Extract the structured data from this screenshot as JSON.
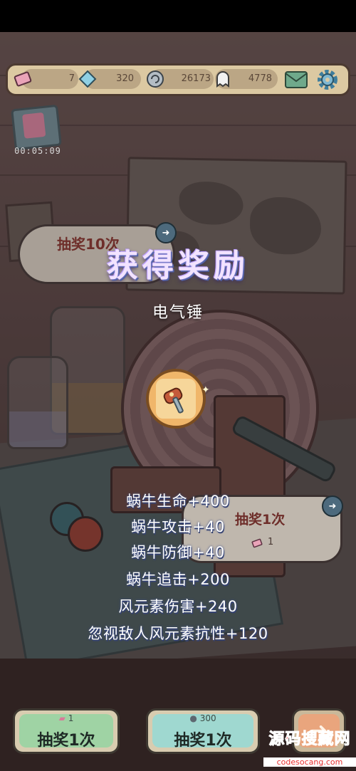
{
  "hud": {
    "tickets": "7",
    "gems": "320",
    "snail_coins": "26173",
    "ghost_coins": "4778",
    "icons": [
      "ticket-icon",
      "gem-icon",
      "snail-coin-icon",
      "ghost-coin-icon",
      "mail-icon",
      "gear-icon"
    ]
  },
  "timer": "00:05:09",
  "draw10_bubble": {
    "label": "抽奖10次"
  },
  "reward": {
    "title": "获得奖励",
    "item_name": "电气锤",
    "item_icon": "electric-hammer-icon",
    "stats": [
      "蜗牛生命+400",
      "蜗牛攻击+40",
      "蜗牛防御+40",
      "蜗牛追击+200",
      "风元素伤害+240",
      "忽视敌人风元素抗性+120"
    ]
  },
  "draw1_bubble": {
    "label": "抽奖1次",
    "cost": "1"
  },
  "buttons": {
    "ticket_draw": {
      "cost": "1",
      "label": "抽奖1次"
    },
    "coin_draw": {
      "cost": "300",
      "label": "抽奖1次"
    }
  },
  "watermark": {
    "title": "源码搜藏网",
    "url": "codesocang.com"
  },
  "colors": {
    "hud_bg": "#dcc9a2",
    "button_green": "#9fd3a4",
    "button_teal": "#9fd8d0",
    "next_button": "#e9a57d"
  }
}
